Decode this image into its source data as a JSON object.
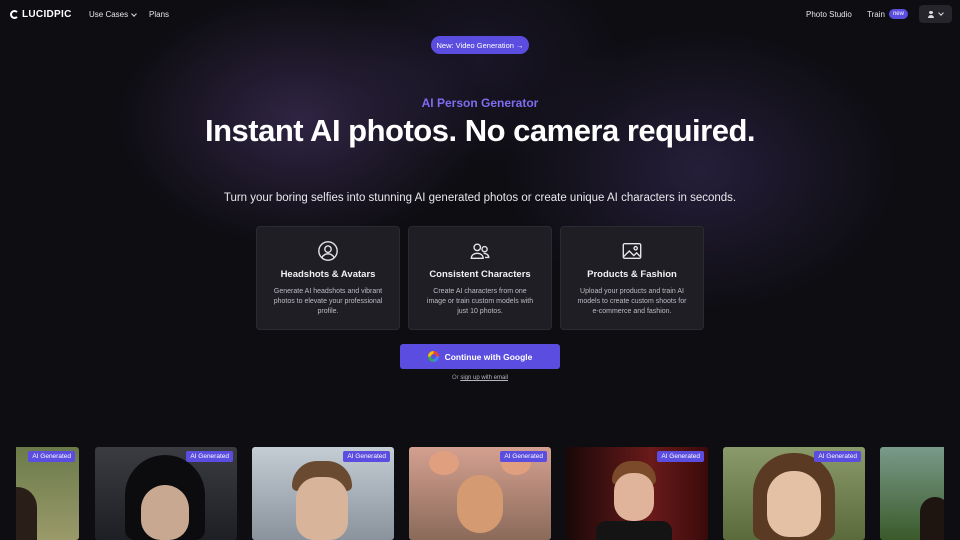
{
  "nav": {
    "logo": "LUCIDPIC",
    "use_cases": "Use Cases",
    "plans": "Plans",
    "photo_studio": "Photo Studio",
    "train": "Train",
    "train_badge": "new"
  },
  "hero": {
    "announcement": "New: Video Generation →",
    "eyebrow": "AI Person Generator",
    "headline": "Instant AI photos. No camera required.",
    "subhead": "Turn your boring selfies into stunning AI generated photos or create unique AI characters in seconds."
  },
  "features": [
    {
      "icon": "user-circle-icon",
      "title": "Headshots & Avatars",
      "desc": "Generate AI headshots and vibrant photos to elevate your professional profile."
    },
    {
      "icon": "users-icon",
      "title": "Consistent Characters",
      "desc": "Create AI characters from one image or train custom models with just 10 photos."
    },
    {
      "icon": "image-icon",
      "title": "Products & Fashion",
      "desc": "Upload your products and train AI models to create custom shoots for e-commerce and fashion."
    }
  ],
  "cta": {
    "google": "Continue with Google",
    "alt_prefix": "Or",
    "alt_link": "sign up with email"
  },
  "gallery": {
    "tag": "AI Generated",
    "colors": [
      "#7a8a4a",
      "#2f3138",
      "#9aa4ae",
      "#c58a6a",
      "#5a1a1a",
      "#7a8a5a",
      "#4a6a3a"
    ]
  },
  "colors": {
    "accent": "#5b4de0",
    "eyebrow": "#7d6cf0",
    "background": "#0e0d12",
    "card": "#1f1e24"
  }
}
